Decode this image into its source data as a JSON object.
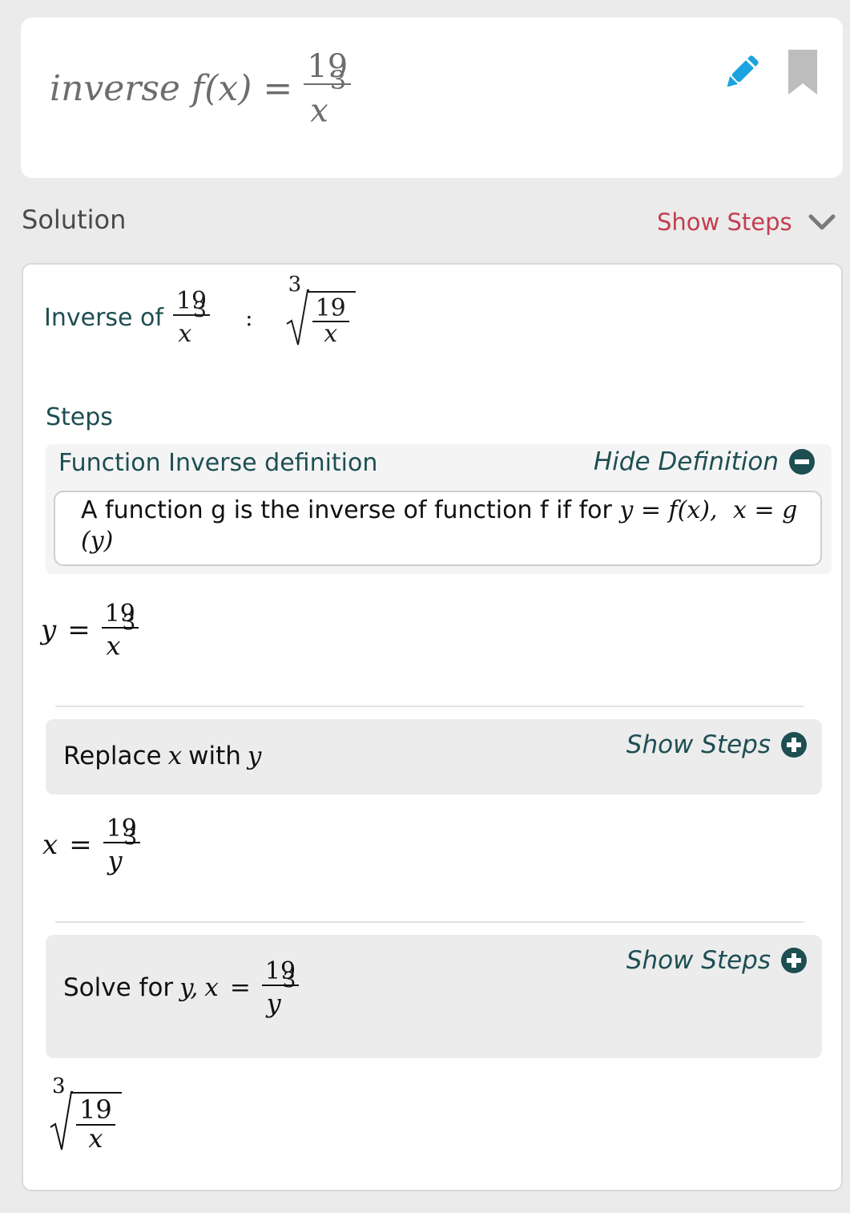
{
  "query": {
    "prefix": "inverse",
    "func": "f(x)",
    "eq": "=",
    "numerator": "19",
    "den_var": "x",
    "den_pow": "3"
  },
  "solution_label": "Solution",
  "show_steps_top": "Show Steps",
  "inverse": {
    "label": "Inverse of",
    "numerator": "19",
    "den_var": "x",
    "den_pow": "3",
    "colon": ":",
    "result_index": "3",
    "result_numerator": "19",
    "result_den": "x"
  },
  "steps_label": "Steps",
  "definition": {
    "title": "Function Inverse definition",
    "toggle": "Hide Definition",
    "text": "A function g is the inverse of function f if for",
    "math_1": "y = f(x),",
    "math_2": "x = g",
    "math_3": "(y)"
  },
  "eq1": {
    "lhs": "y",
    "eq": "=",
    "numerator": "19",
    "den_var": "x",
    "den_pow": "3"
  },
  "step1": {
    "text": "Replace",
    "var1": "x",
    "mid": "with",
    "var2": "y",
    "show": "Show Steps"
  },
  "eq2": {
    "lhs": "x",
    "eq": "=",
    "numerator": "19",
    "den_var": "y",
    "den_pow": "3"
  },
  "step2": {
    "text": "Solve for",
    "var": "y,",
    "lhs": "x",
    "eq": "=",
    "numerator": "19",
    "den_var": "y",
    "den_pow": "3",
    "show": "Show Steps"
  },
  "final": {
    "index": "3",
    "numerator": "19",
    "den": "x"
  },
  "colors": {
    "accent_red": "#c43d4f",
    "accent_blue": "#1aa3e0",
    "teal": "#1d4e52",
    "gray_bookmark": "#bdbdbd"
  },
  "icons": [
    "pencil-icon",
    "bookmark-icon",
    "chevron-down-icon",
    "minus-circle-icon",
    "plus-circle-icon"
  ]
}
